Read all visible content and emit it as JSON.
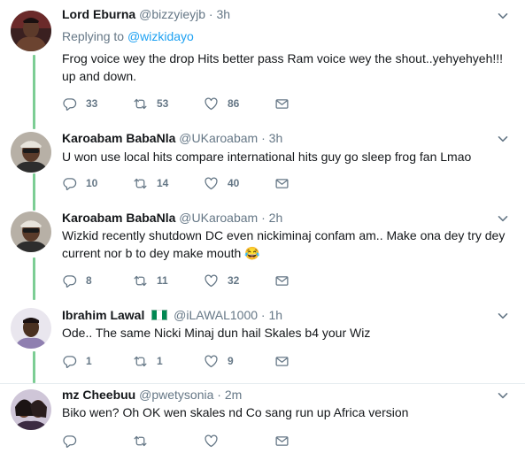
{
  "colors": {
    "text": "#14171a",
    "secondary": "#657786",
    "link": "#1da1f2",
    "thread_line": "#7ccd94",
    "divider": "#e6ecf0"
  },
  "icons": [
    "reply-icon",
    "retweet-icon",
    "like-icon",
    "dm-icon",
    "chevron-down-icon",
    "nigeria-flag-icon",
    "laughing-emoji-icon"
  ],
  "tweets": [
    {
      "name": "Lord Eburna",
      "handle": "@bizzyieyjb",
      "separator": "·",
      "time": "3h",
      "replying_label": "Replying to",
      "replying_to": "@wizkidayo",
      "text": "Frog voice wey the drop Hits better pass Ram voice wey the shout..yehyehyeh!!! up and down.",
      "replies": "33",
      "retweets": "53",
      "likes": "86"
    },
    {
      "name": "Karoabam BabaNla",
      "handle": "@UKaroabam",
      "separator": "·",
      "time": "3h",
      "text": "U won use local hits compare international hits guy go sleep frog fan Lmao",
      "replies": "10",
      "retweets": "14",
      "likes": "40"
    },
    {
      "name": "Karoabam BabaNla",
      "handle": "@UKaroabam",
      "separator": "·",
      "time": "2h",
      "text": "Wizkid recently shutdown DC even nickiminaj confam am.. Make ona dey try dey current nor b to dey make mouth",
      "emoji": "😂",
      "replies": "8",
      "retweets": "11",
      "likes": "32"
    },
    {
      "name": "Ibrahim Lawal",
      "handle": "@iLAWAL1000",
      "separator": "·",
      "time": "1h",
      "text": "Ode.. The same Nicki Minaj dun hail Skales b4 your Wiz",
      "replies": "1",
      "retweets": "1",
      "likes": "9"
    },
    {
      "name": "mz Cheebuu",
      "handle": "@pwetysonia",
      "separator": "·",
      "time": "2m",
      "text": "Biko wen? Oh OK wen skales nd Co sang run up Africa version",
      "replies": "",
      "retweets": "",
      "likes": ""
    }
  ]
}
